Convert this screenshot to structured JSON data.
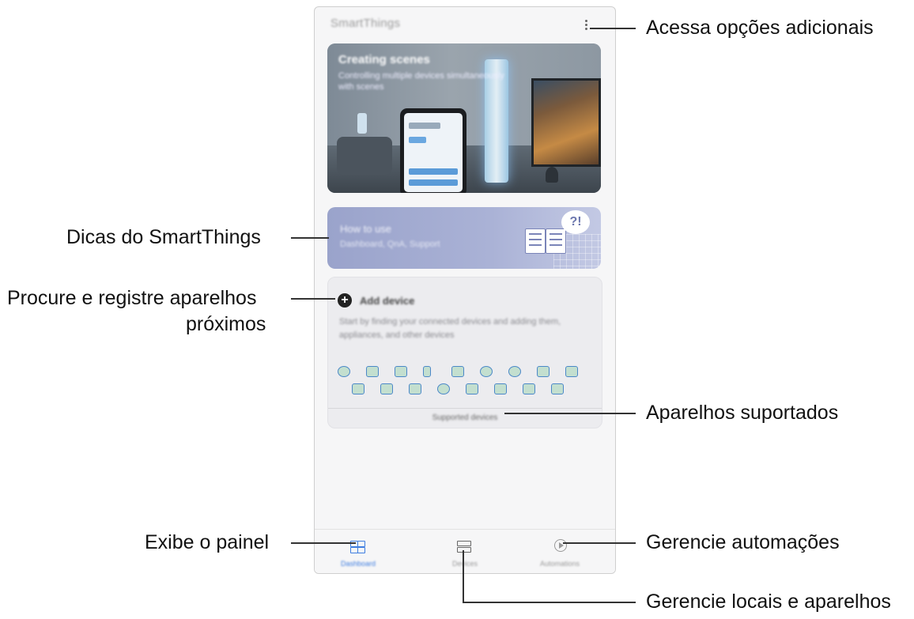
{
  "app": {
    "title": "SmartThings"
  },
  "banner": {
    "title": "Creating scenes",
    "subtitle": "Controlling multiple devices simultaneously with scenes"
  },
  "tips_card": {
    "title": "How to use",
    "subtitle": "Dashboard, QnA, Support",
    "bubble_text": "?!"
  },
  "add_device": {
    "title": "Add device",
    "description": "Start by finding your connected devices and adding them, appliances, and other devices",
    "supported_button_label": "Supported devices"
  },
  "bottom_nav": {
    "items": [
      {
        "label": "Dashboard",
        "icon": "dashboard-icon",
        "active": true
      },
      {
        "label": "Devices",
        "icon": "devices-icon",
        "active": false
      },
      {
        "label": "Automations",
        "icon": "automations-icon",
        "active": false
      }
    ]
  },
  "annotations": {
    "more_options": "Acessa opções adicionais",
    "tips": "Dicas do SmartThings",
    "search_register_line1": "Procure e registre aparelhos",
    "search_register_line2": "próximos",
    "supported_devices": "Aparelhos suportados",
    "dashboard": "Exibe o painel",
    "automations": "Gerencie automações",
    "locations_devices": "Gerencie locais e aparelhos"
  },
  "colors": {
    "accent": "#3e7de0",
    "tips_card": "#aab2d6"
  }
}
